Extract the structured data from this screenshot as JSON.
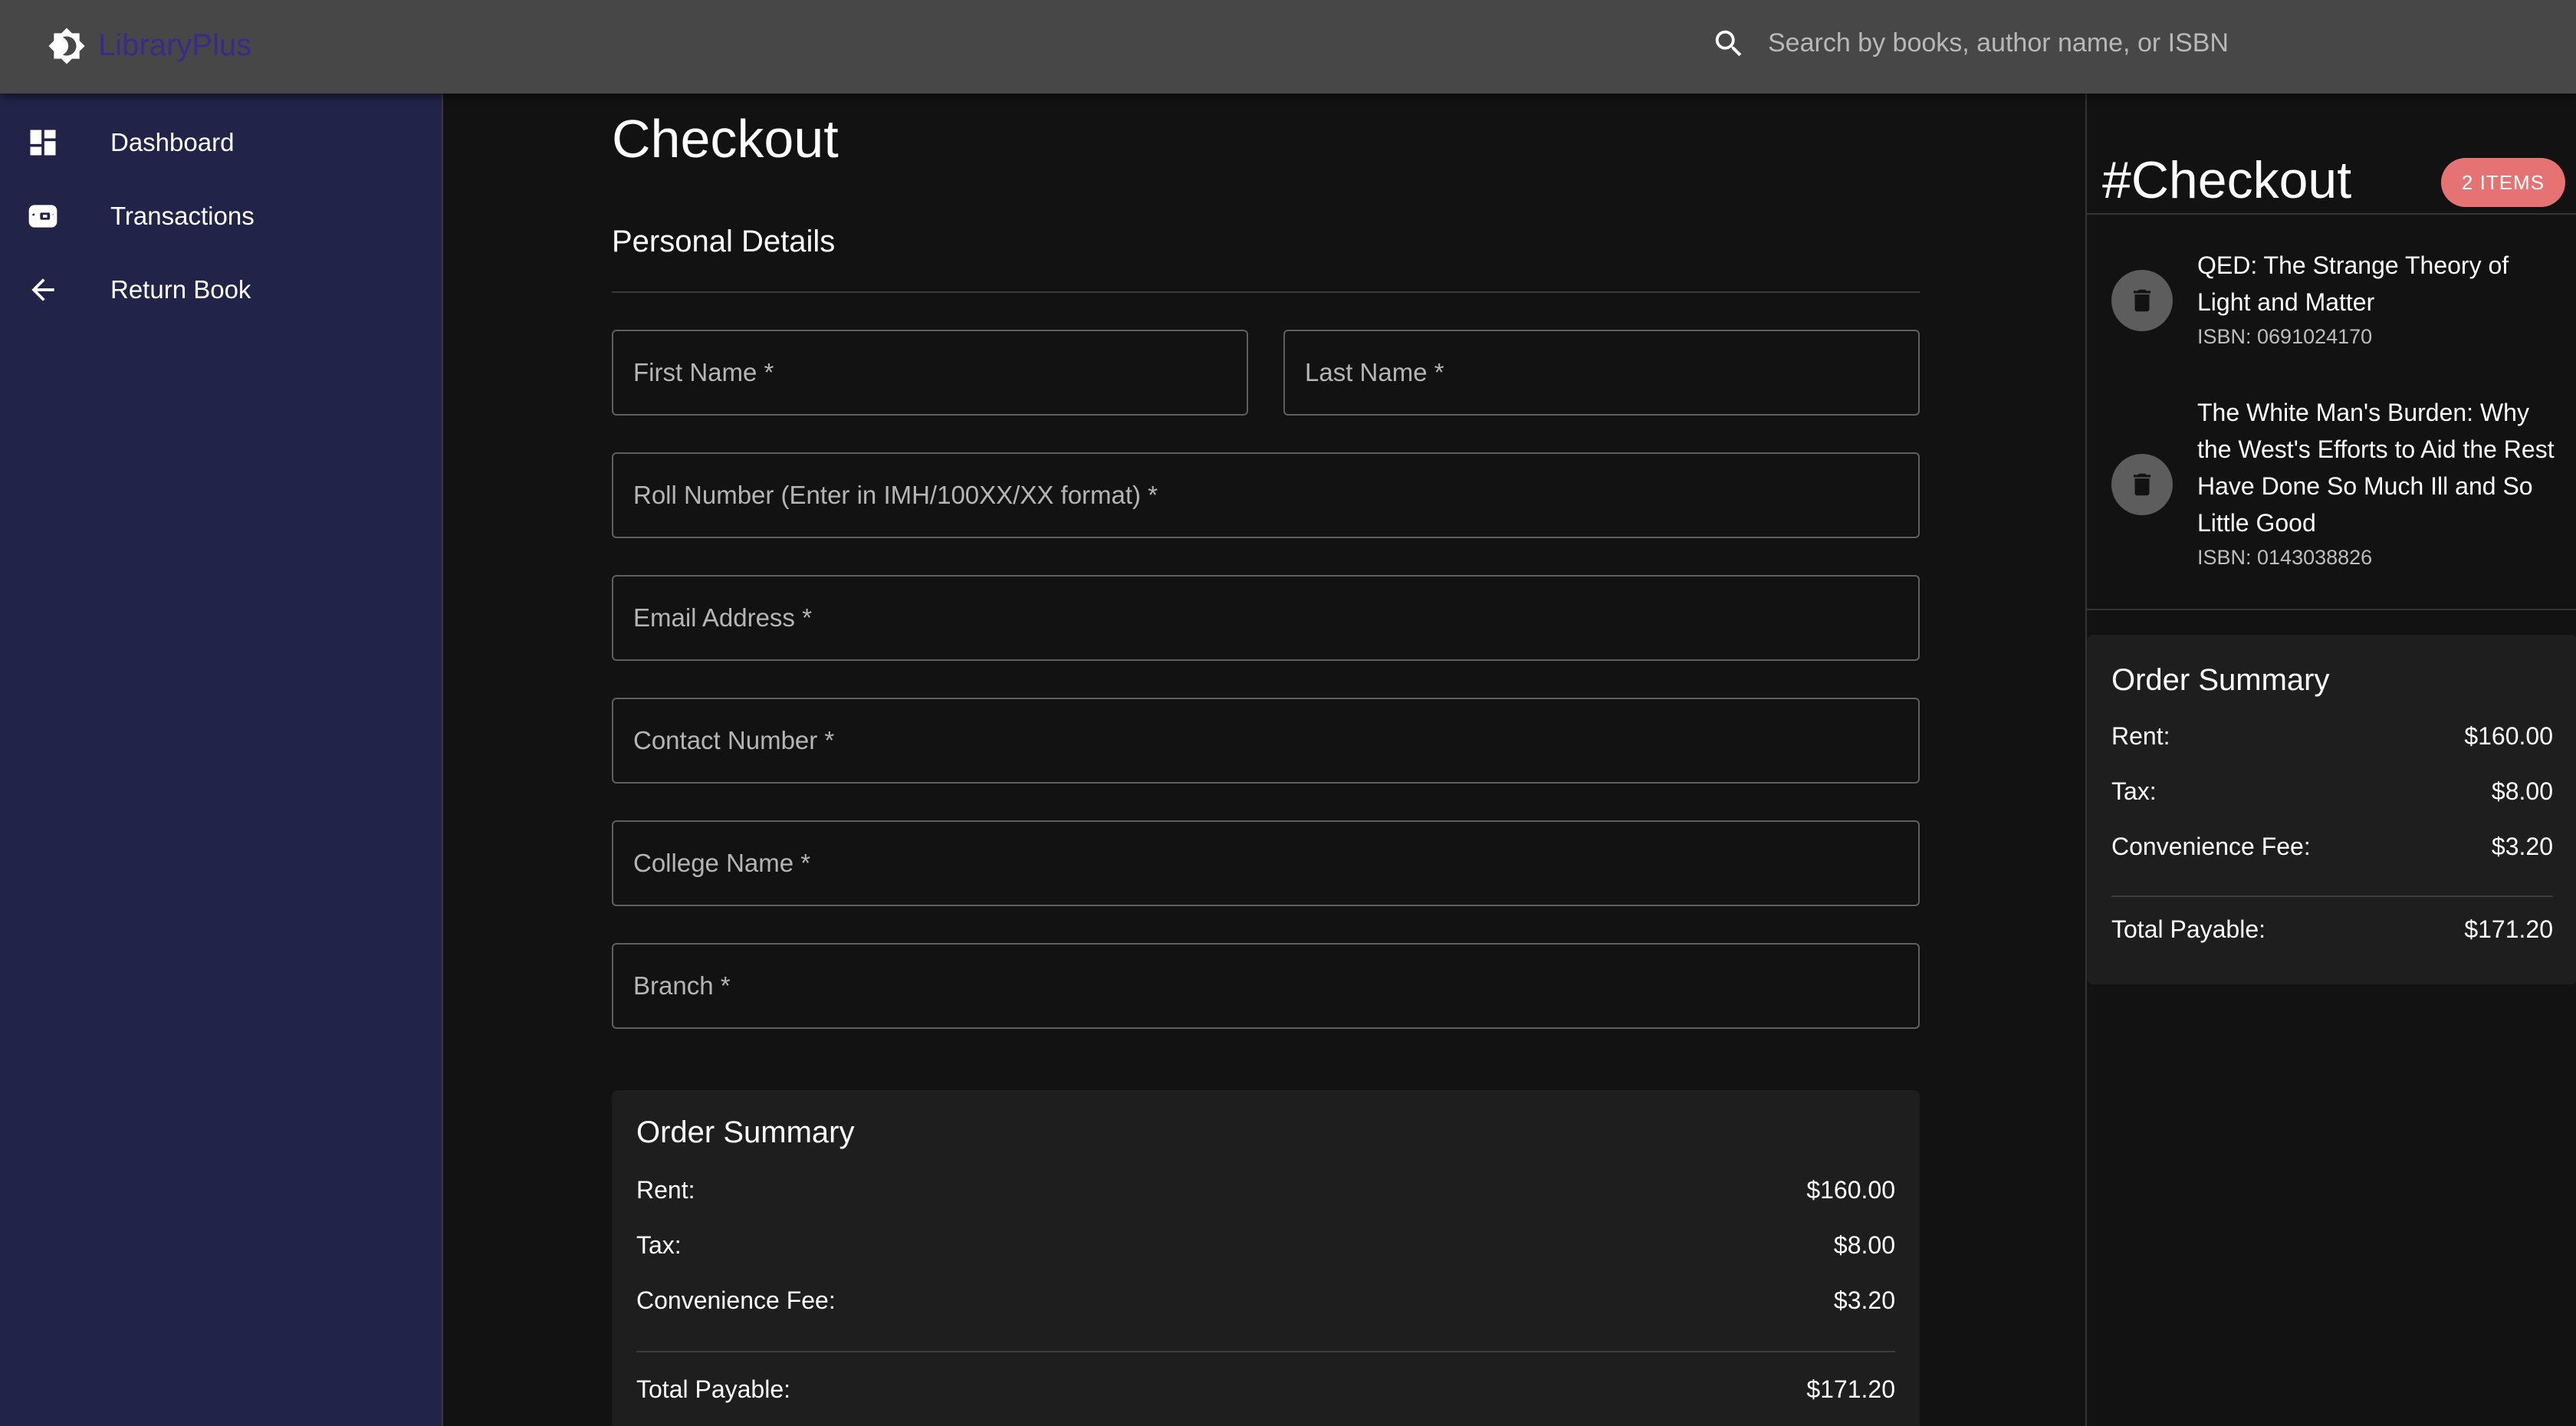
{
  "app": {
    "name": "LibraryPlus",
    "logo_icon": "brightness-icon"
  },
  "search": {
    "placeholder": "Search by books, author name, or ISBN",
    "icon": "search-icon"
  },
  "sidebar": {
    "items": [
      {
        "label": "Dashboard",
        "icon": "dashboard-icon"
      },
      {
        "label": "Transactions",
        "icon": "wallet-icon"
      },
      {
        "label": "Return Book",
        "icon": "arrow-back-icon"
      }
    ]
  },
  "main": {
    "title": "Checkout",
    "section_title": "Personal Details",
    "fields": {
      "first_name": {
        "placeholder": "First Name *",
        "value": ""
      },
      "last_name": {
        "placeholder": "Last Name *",
        "value": ""
      },
      "roll_number": {
        "placeholder": "Roll Number (Enter in IMH/100XX/XX format) *",
        "value": ""
      },
      "email": {
        "placeholder": "Email Address *",
        "value": ""
      },
      "contact": {
        "placeholder": "Contact Number *",
        "value": ""
      },
      "college": {
        "placeholder": "College Name *",
        "value": ""
      },
      "branch": {
        "placeholder": "Branch *",
        "value": ""
      }
    }
  },
  "order_summary": {
    "title": "Order Summary",
    "rent_label": "Rent:",
    "rent_value": "$160.00",
    "tax_label": "Tax:",
    "tax_value": "$8.00",
    "fee_label": "Convenience Fee:",
    "fee_value": "$3.20",
    "total_label": "Total Payable:",
    "total_value": "$171.20"
  },
  "cart": {
    "title": "#Checkout",
    "badge": "2 ITEMS",
    "badge_color": "#e57373",
    "items": [
      {
        "title": "QED: The Strange Theory of Light and Matter",
        "isbn": "ISBN: 0691024170"
      },
      {
        "title": "The White Man's Burden: Why the West's Efforts to Aid the Rest Have Done So Much Ill and So Little Good",
        "isbn": "ISBN: 0143038826"
      }
    ]
  },
  "colors": {
    "appbar": "#474747",
    "sidebar": "#222349",
    "background": "#121212",
    "card": "#1e1e1e",
    "brand_text": "#3a2a8c"
  }
}
